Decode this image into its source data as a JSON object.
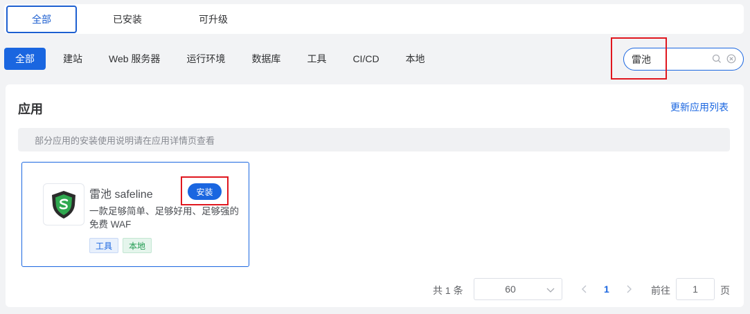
{
  "top_tabs": [
    {
      "label": "全部",
      "active": true
    },
    {
      "label": "已安装",
      "active": false
    },
    {
      "label": "可升级",
      "active": false
    }
  ],
  "categories": [
    {
      "label": "全部",
      "active": true
    },
    {
      "label": "建站",
      "active": false
    },
    {
      "label": "Web 服务器",
      "active": false
    },
    {
      "label": "运行环境",
      "active": false
    },
    {
      "label": "数据库",
      "active": false
    },
    {
      "label": "工具",
      "active": false
    },
    {
      "label": "CI/CD",
      "active": false
    },
    {
      "label": "本地",
      "active": false
    }
  ],
  "search": {
    "value": "雷池",
    "icon": "search-icon",
    "clear_icon": "circle-close-icon"
  },
  "panel": {
    "title": "应用",
    "refresh_label": "更新应用列表",
    "notice": "部分应用的安装使用说明请在应用详情页查看"
  },
  "app": {
    "name": "雷池 safeline",
    "install_label": "安装",
    "description": "一款足够简单、足够好用、足够强的免费 WAF",
    "tags": [
      {
        "label": "工具",
        "color": "blue"
      },
      {
        "label": "本地",
        "color": "green"
      }
    ],
    "logo_icon": "safeline-shield-logo"
  },
  "pagination": {
    "total_text": "共 1 条",
    "page_size": "60",
    "current_page": "1",
    "goto_label": "前往",
    "goto_value": "1",
    "page_unit": "页"
  },
  "colors": {
    "accent": "#1a66e0",
    "highlight": "#e0161e",
    "tag_green": "#1f9a4f"
  }
}
